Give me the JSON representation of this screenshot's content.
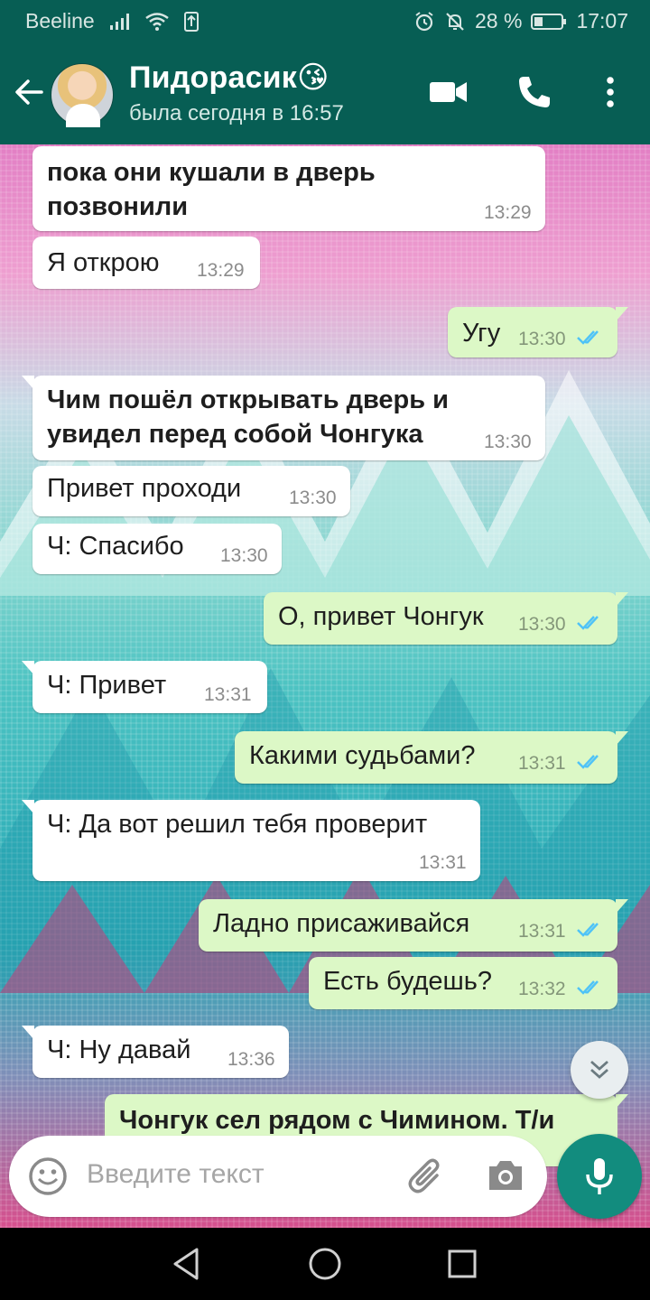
{
  "status_bar": {
    "carrier": "Beeline",
    "battery": "28 %",
    "time": "17:07"
  },
  "header": {
    "contact_name": "Пидорасик😘",
    "last_seen": "была сегодня в 16:57"
  },
  "messages": [
    {
      "dir": "in",
      "text": [
        "пока они кушали в дверь",
        "позвонили"
      ],
      "bold": true,
      "time": "13:29"
    },
    {
      "dir": "in",
      "text": [
        "Я открою"
      ],
      "time": "13:29"
    },
    {
      "dir": "out",
      "text": [
        "Угу"
      ],
      "time": "13:30"
    },
    {
      "dir": "in",
      "text": [
        "Чим пошёл открывать дверь и",
        "увидел перед собой Чонгука"
      ],
      "bold": true,
      "time": "13:30"
    },
    {
      "dir": "in",
      "text": [
        "Привет проходи"
      ],
      "time": "13:30"
    },
    {
      "dir": "in",
      "text": [
        "Ч: Спасибо"
      ],
      "time": "13:30"
    },
    {
      "dir": "out",
      "text": [
        "О, привет Чонгук"
      ],
      "time": "13:30"
    },
    {
      "dir": "in",
      "text": [
        "Ч: Привет"
      ],
      "time": "13:31"
    },
    {
      "dir": "out",
      "text": [
        "Какими судьбами?"
      ],
      "time": "13:31"
    },
    {
      "dir": "in",
      "text": [
        "Ч: Да вот решил тебя проверит"
      ],
      "time": "13:31"
    },
    {
      "dir": "out",
      "text": [
        "Ладно присаживайся"
      ],
      "time": "13:31"
    },
    {
      "dir": "out",
      "text": [
        "Есть будешь?"
      ],
      "time": "13:32"
    },
    {
      "dir": "in",
      "text": [
        "Ч: Ну давай"
      ],
      "time": "13:36"
    },
    {
      "dir": "out",
      "text": [
        "Чонгук сел рядом с Чимином. Т/и"
      ],
      "bold": true,
      "time": ""
    }
  ],
  "composer": {
    "placeholder": "Введите текст"
  },
  "colors": {
    "header": "#075e54",
    "incoming_bubble": "#ffffff",
    "outgoing_bubble": "#dcf8c6",
    "read_ticks": "#4fc3f7",
    "mic_button": "#128c7e"
  },
  "icons": [
    "back-arrow-icon",
    "video-call-icon",
    "phone-icon",
    "more-vert-icon",
    "emoji-icon",
    "attach-icon",
    "camera-icon",
    "mic-icon",
    "chevron-down-icon",
    "nav-back-icon",
    "nav-home-icon",
    "nav-recents-icon"
  ]
}
